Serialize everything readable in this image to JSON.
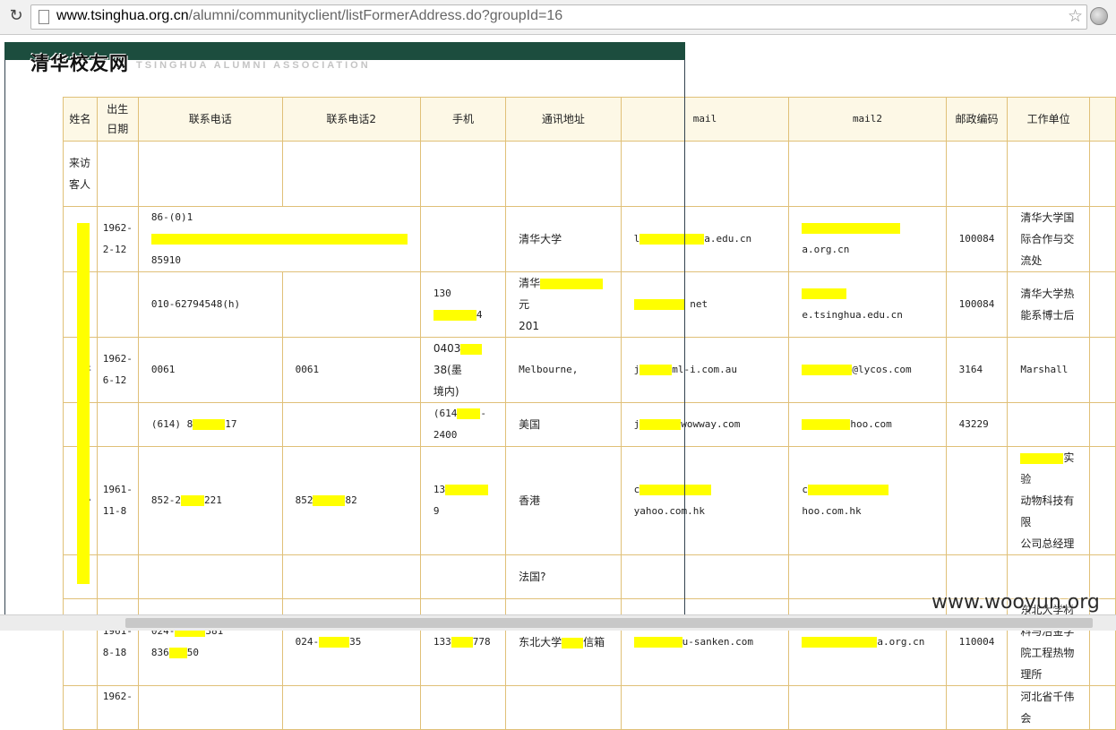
{
  "browser": {
    "url_host": "www.tsinghua.org.cn",
    "url_path": "/alumni/communityclient/listFormerAddress.do?groupId=16"
  },
  "site": {
    "logo_text": "清华校友网",
    "logo_subtitle": "TSINGHUA ALUMNI ASSOCIATION"
  },
  "table": {
    "headers": [
      "姓名",
      "出生日期",
      "联系电话",
      "联系电话2",
      "手机",
      "通讯地址",
      "mail",
      "mail2",
      "邮政编码",
      "工作单位"
    ],
    "rows": [
      [
        "来访客人",
        "",
        "",
        "",
        "",
        "",
        "",
        "",
        "",
        ""
      ],
      [
        "",
        "1962-2-12",
        "86-(0)1",
        "",
        "",
        "清华大学",
        "l",
        "",
        "100084",
        "清华大学国际合作与交流处"
      ],
      [
        "",
        "",
        "010-62794548(h)",
        "",
        "130",
        "清华",
        "",
        "",
        "100084",
        "清华大学热能系博士后"
      ],
      [
        "许",
        "1962-6-12",
        "0061",
        "0061",
        "0403",
        "Melbourne,",
        "j",
        "",
        "3164",
        "Marshall"
      ],
      [
        "",
        "",
        "(614) 8",
        "",
        "(614",
        "美国",
        "j",
        "",
        "43229",
        ""
      ],
      [
        "少",
        "1961-11-8",
        "852-2",
        "852",
        "13",
        "香港",
        "c",
        "c",
        "",
        "实验动物科技有限公司总经理"
      ],
      [
        "",
        "",
        "",
        "",
        "",
        "法国?",
        "",
        "",
        "",
        ""
      ],
      [
        "",
        "1961-8-18",
        "024-",
        "024-",
        "133",
        "东北大学",
        "",
        "",
        "110004",
        "东北大学材料与冶金学院工程热物理所"
      ],
      [
        "",
        "1962-",
        "",
        "",
        "",
        "",
        "",
        "",
        "",
        ""
      ]
    ],
    "partial_texts": {
      "r1_phone_tail": "85910",
      "r1_mail_tail": "a.edu.cn",
      "r1_mail2_tail": "a.org.cn",
      "r2_mobile_tail": "4",
      "r2_addr_tail": "元",
      "r2_addr_line2": "201",
      "r2_mail_tail": "net",
      "r2_mail2_tail": "e.tsinghua.edu.cn",
      "r3_mobile_tail": "38(墨",
      "r3_mobile_line2": "境内)",
      "r3_mail_tail": "ml-i.com.au",
      "r3_mail2_tail": "@lycos.com",
      "r4_phone_tail": "17",
      "r4_mobile_tail": "-",
      "r4_mobile_line2": "2400",
      "r4_mail_tail": "wowway.com",
      "r4_mail2_tail": "hoo.com",
      "r5_phone_tail": "221",
      "r5_phone2_tail": "82",
      "r5_mobile_tail": "9",
      "r5_mail_tail": "yahoo.com.hk",
      "r5_mail2_tail": "hoo.com.hk",
      "r5_work_tail": "实验",
      "r5_work_line2": "动物科技有限",
      "r5_work_line3": "公司总经理",
      "r7_phone_tail": "381",
      "r7_phone_line2": "836",
      "r7_phone_line2_tail": "50",
      "r7_phone2_tail": "35",
      "r7_mobile_tail": "778",
      "r7_addr_tail": "信箱",
      "r7_mail_tail": "u-sanken.com",
      "r7_mail2_tail": "a.org.cn",
      "r8_work": "河北省千伟会"
    }
  },
  "watermark": "www.wooyun.org",
  "colors": {
    "header_green": "#1c4d3e",
    "table_border": "#e0c078",
    "header_bg": "#fdf8e6",
    "redaction": "#ffff00"
  }
}
